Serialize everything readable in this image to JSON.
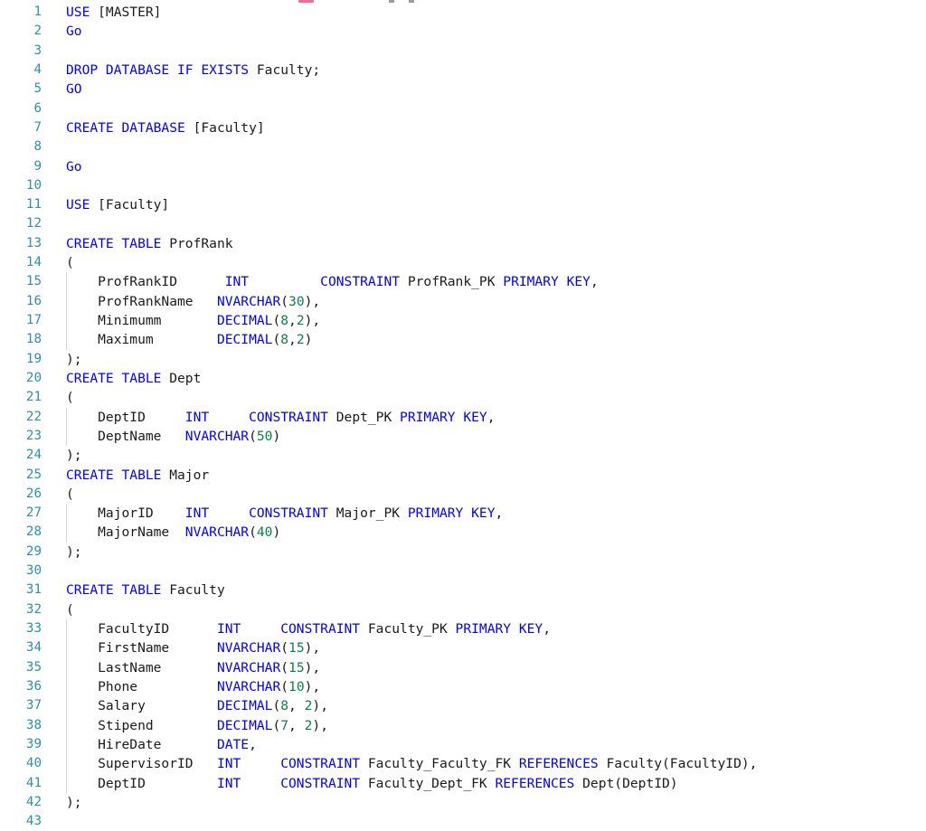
{
  "app": {
    "kind": "sql-code-editor",
    "language": "T-SQL",
    "colors": {
      "background": "#ffffff",
      "keyword": "#0000ff",
      "number": "#09804a",
      "identifier": "#1a1a1a",
      "line_number": "#2b8fae",
      "indent_guide": "#d6d6d6",
      "toolbar_accent": "#f2699b"
    }
  },
  "gutter": {
    "first_line": 1,
    "last_line": 43
  },
  "code": {
    "lines": [
      {
        "n": "1",
        "indent": false,
        "tokens": [
          {
            "t": "USE",
            "c": "kw"
          },
          {
            "t": " [MASTER]",
            "c": "id"
          }
        ]
      },
      {
        "n": "2",
        "indent": false,
        "tokens": [
          {
            "t": "Go",
            "c": "kw"
          }
        ]
      },
      {
        "n": "3",
        "indent": false,
        "tokens": []
      },
      {
        "n": "4",
        "indent": false,
        "tokens": [
          {
            "t": "DROP DATABASE IF EXISTS",
            "c": "kw"
          },
          {
            "t": " Faculty;",
            "c": "id"
          }
        ]
      },
      {
        "n": "5",
        "indent": false,
        "tokens": [
          {
            "t": "GO",
            "c": "kw"
          }
        ]
      },
      {
        "n": "6",
        "indent": false,
        "tokens": []
      },
      {
        "n": "7",
        "indent": false,
        "tokens": [
          {
            "t": "CREATE DATABASE",
            "c": "kw"
          },
          {
            "t": " [Faculty]",
            "c": "id"
          }
        ]
      },
      {
        "n": "8",
        "indent": false,
        "tokens": []
      },
      {
        "n": "9",
        "indent": false,
        "tokens": [
          {
            "t": "Go",
            "c": "kw"
          }
        ]
      },
      {
        "n": "10",
        "indent": false,
        "tokens": []
      },
      {
        "n": "11",
        "indent": false,
        "tokens": [
          {
            "t": "USE",
            "c": "kw"
          },
          {
            "t": " [Faculty]",
            "c": "id"
          }
        ]
      },
      {
        "n": "12",
        "indent": false,
        "tokens": []
      },
      {
        "n": "13",
        "indent": false,
        "tokens": [
          {
            "t": "CREATE TABLE",
            "c": "kw"
          },
          {
            "t": " ProfRank",
            "c": "id"
          }
        ]
      },
      {
        "n": "14",
        "indent": false,
        "tokens": [
          {
            "t": "(",
            "c": "punc"
          }
        ]
      },
      {
        "n": "15",
        "indent": true,
        "tokens": [
          {
            "t": "    ProfRankID      ",
            "c": "id"
          },
          {
            "t": "INT",
            "c": "kw"
          },
          {
            "t": "         ",
            "c": "id"
          },
          {
            "t": "CONSTRAINT",
            "c": "kw"
          },
          {
            "t": " ProfRank_PK ",
            "c": "id"
          },
          {
            "t": "PRIMARY KEY",
            "c": "kw"
          },
          {
            "t": ",",
            "c": "punc"
          }
        ]
      },
      {
        "n": "16",
        "indent": true,
        "tokens": [
          {
            "t": "    ProfRankName   ",
            "c": "id"
          },
          {
            "t": "NVARCHAR",
            "c": "kw"
          },
          {
            "t": "(",
            "c": "punc"
          },
          {
            "t": "30",
            "c": "num"
          },
          {
            "t": "),",
            "c": "punc"
          }
        ]
      },
      {
        "n": "17",
        "indent": true,
        "tokens": [
          {
            "t": "    Minimumm       ",
            "c": "id"
          },
          {
            "t": "DECIMAL",
            "c": "kw"
          },
          {
            "t": "(",
            "c": "punc"
          },
          {
            "t": "8",
            "c": "num"
          },
          {
            "t": ",",
            "c": "punc"
          },
          {
            "t": "2",
            "c": "num"
          },
          {
            "t": "),",
            "c": "punc"
          }
        ]
      },
      {
        "n": "18",
        "indent": true,
        "tokens": [
          {
            "t": "    Maximum        ",
            "c": "id"
          },
          {
            "t": "DECIMAL",
            "c": "kw"
          },
          {
            "t": "(",
            "c": "punc"
          },
          {
            "t": "8",
            "c": "num"
          },
          {
            "t": ",",
            "c": "punc"
          },
          {
            "t": "2",
            "c": "num"
          },
          {
            "t": ")",
            "c": "punc"
          }
        ]
      },
      {
        "n": "19",
        "indent": false,
        "tokens": [
          {
            "t": ");",
            "c": "punc"
          }
        ]
      },
      {
        "n": "20",
        "indent": false,
        "tokens": [
          {
            "t": "CREATE TABLE",
            "c": "kw"
          },
          {
            "t": " Dept",
            "c": "id"
          }
        ]
      },
      {
        "n": "21",
        "indent": false,
        "tokens": [
          {
            "t": "(",
            "c": "punc"
          }
        ]
      },
      {
        "n": "22",
        "indent": true,
        "tokens": [
          {
            "t": "    DeptID     ",
            "c": "id"
          },
          {
            "t": "INT",
            "c": "kw"
          },
          {
            "t": "     ",
            "c": "id"
          },
          {
            "t": "CONSTRAINT",
            "c": "kw"
          },
          {
            "t": " Dept_PK ",
            "c": "id"
          },
          {
            "t": "PRIMARY KEY",
            "c": "kw"
          },
          {
            "t": ",",
            "c": "punc"
          }
        ]
      },
      {
        "n": "23",
        "indent": true,
        "tokens": [
          {
            "t": "    DeptName   ",
            "c": "id"
          },
          {
            "t": "NVARCHAR",
            "c": "kw"
          },
          {
            "t": "(",
            "c": "punc"
          },
          {
            "t": "50",
            "c": "num"
          },
          {
            "t": ")",
            "c": "punc"
          }
        ]
      },
      {
        "n": "24",
        "indent": false,
        "tokens": [
          {
            "t": ");",
            "c": "punc"
          }
        ]
      },
      {
        "n": "25",
        "indent": false,
        "tokens": [
          {
            "t": "CREATE TABLE",
            "c": "kw"
          },
          {
            "t": " Major",
            "c": "id"
          }
        ]
      },
      {
        "n": "26",
        "indent": false,
        "tokens": [
          {
            "t": "(",
            "c": "punc"
          }
        ]
      },
      {
        "n": "27",
        "indent": true,
        "tokens": [
          {
            "t": "    MajorID    ",
            "c": "id"
          },
          {
            "t": "INT",
            "c": "kw"
          },
          {
            "t": "     ",
            "c": "id"
          },
          {
            "t": "CONSTRAINT",
            "c": "kw"
          },
          {
            "t": " Major_PK ",
            "c": "id"
          },
          {
            "t": "PRIMARY KEY",
            "c": "kw"
          },
          {
            "t": ",",
            "c": "punc"
          }
        ]
      },
      {
        "n": "28",
        "indent": true,
        "tokens": [
          {
            "t": "    MajorName  ",
            "c": "id"
          },
          {
            "t": "NVARCHAR",
            "c": "kw"
          },
          {
            "t": "(",
            "c": "punc"
          },
          {
            "t": "40",
            "c": "num"
          },
          {
            "t": ")",
            "c": "punc"
          }
        ]
      },
      {
        "n": "29",
        "indent": false,
        "tokens": [
          {
            "t": ");",
            "c": "punc"
          }
        ]
      },
      {
        "n": "30",
        "indent": false,
        "tokens": []
      },
      {
        "n": "31",
        "indent": false,
        "tokens": [
          {
            "t": "CREATE TABLE",
            "c": "kw"
          },
          {
            "t": " Faculty",
            "c": "id"
          }
        ]
      },
      {
        "n": "32",
        "indent": false,
        "tokens": [
          {
            "t": "(",
            "c": "punc"
          }
        ]
      },
      {
        "n": "33",
        "indent": true,
        "tokens": [
          {
            "t": "    FacultyID      ",
            "c": "id"
          },
          {
            "t": "INT",
            "c": "kw"
          },
          {
            "t": "     ",
            "c": "id"
          },
          {
            "t": "CONSTRAINT",
            "c": "kw"
          },
          {
            "t": " Faculty_PK ",
            "c": "id"
          },
          {
            "t": "PRIMARY KEY",
            "c": "kw"
          },
          {
            "t": ",",
            "c": "punc"
          }
        ]
      },
      {
        "n": "34",
        "indent": true,
        "tokens": [
          {
            "t": "    FirstName      ",
            "c": "id"
          },
          {
            "t": "NVARCHAR",
            "c": "kw"
          },
          {
            "t": "(",
            "c": "punc"
          },
          {
            "t": "15",
            "c": "num"
          },
          {
            "t": "),",
            "c": "punc"
          }
        ]
      },
      {
        "n": "35",
        "indent": true,
        "tokens": [
          {
            "t": "    LastName       ",
            "c": "id"
          },
          {
            "t": "NVARCHAR",
            "c": "kw"
          },
          {
            "t": "(",
            "c": "punc"
          },
          {
            "t": "15",
            "c": "num"
          },
          {
            "t": "),",
            "c": "punc"
          }
        ]
      },
      {
        "n": "36",
        "indent": true,
        "tokens": [
          {
            "t": "    Phone          ",
            "c": "id"
          },
          {
            "t": "NVARCHAR",
            "c": "kw"
          },
          {
            "t": "(",
            "c": "punc"
          },
          {
            "t": "10",
            "c": "num"
          },
          {
            "t": "),",
            "c": "punc"
          }
        ]
      },
      {
        "n": "37",
        "indent": true,
        "tokens": [
          {
            "t": "    Salary         ",
            "c": "id"
          },
          {
            "t": "DECIMAL",
            "c": "kw"
          },
          {
            "t": "(",
            "c": "punc"
          },
          {
            "t": "8",
            "c": "num"
          },
          {
            "t": ", ",
            "c": "punc"
          },
          {
            "t": "2",
            "c": "num"
          },
          {
            "t": "),",
            "c": "punc"
          }
        ]
      },
      {
        "n": "38",
        "indent": true,
        "tokens": [
          {
            "t": "    Stipend        ",
            "c": "id"
          },
          {
            "t": "DECIMAL",
            "c": "kw"
          },
          {
            "t": "(",
            "c": "punc"
          },
          {
            "t": "7",
            "c": "num"
          },
          {
            "t": ", ",
            "c": "punc"
          },
          {
            "t": "2",
            "c": "num"
          },
          {
            "t": "),",
            "c": "punc"
          }
        ]
      },
      {
        "n": "39",
        "indent": true,
        "tokens": [
          {
            "t": "    HireDate       ",
            "c": "id"
          },
          {
            "t": "DATE",
            "c": "kw"
          },
          {
            "t": ",",
            "c": "punc"
          }
        ]
      },
      {
        "n": "40",
        "indent": true,
        "tokens": [
          {
            "t": "    SupervisorID   ",
            "c": "id"
          },
          {
            "t": "INT",
            "c": "kw"
          },
          {
            "t": "     ",
            "c": "id"
          },
          {
            "t": "CONSTRAINT",
            "c": "kw"
          },
          {
            "t": " Faculty_Faculty_FK ",
            "c": "id"
          },
          {
            "t": "REFERENCES",
            "c": "kw"
          },
          {
            "t": " Faculty(FacultyID),",
            "c": "id"
          }
        ]
      },
      {
        "n": "41",
        "indent": true,
        "tokens": [
          {
            "t": "    DeptID         ",
            "c": "id"
          },
          {
            "t": "INT",
            "c": "kw"
          },
          {
            "t": "     ",
            "c": "id"
          },
          {
            "t": "CONSTRAINT",
            "c": "kw"
          },
          {
            "t": " Faculty_Dept_FK ",
            "c": "id"
          },
          {
            "t": "REFERENCES",
            "c": "kw"
          },
          {
            "t": " Dept(DeptID)",
            "c": "id"
          }
        ]
      },
      {
        "n": "42",
        "indent": false,
        "tokens": [
          {
            "t": ");",
            "c": "punc"
          }
        ]
      },
      {
        "n": "43",
        "indent": false,
        "tokens": []
      }
    ]
  }
}
